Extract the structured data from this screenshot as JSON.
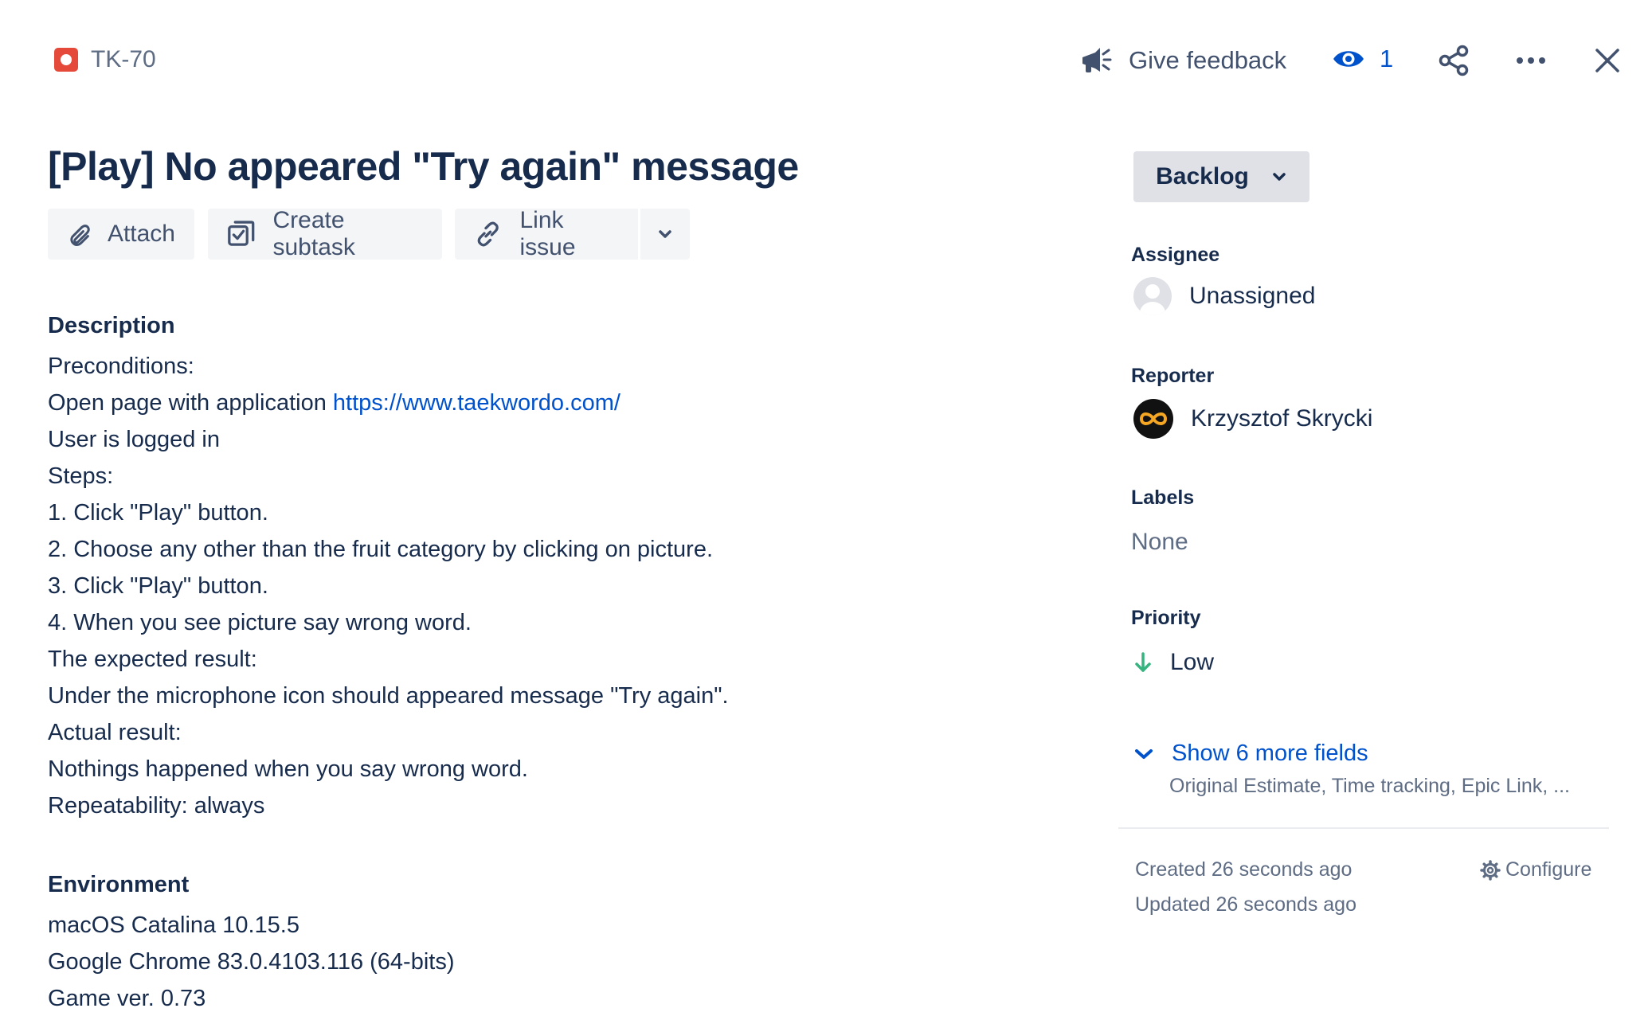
{
  "header": {
    "issue_key": "TK-70",
    "feedback_label": "Give feedback",
    "watch_count": "1",
    "icons": [
      "bug-icon",
      "megaphone-icon",
      "eye-icon",
      "share-icon",
      "more-icon",
      "close-icon"
    ]
  },
  "issue": {
    "title": "[Play] No appeared \"Try again\" message"
  },
  "toolbar": {
    "attach_label": "Attach",
    "create_subtask_label": "Create subtask",
    "link_issue_label": "Link issue"
  },
  "description": {
    "heading": "Description",
    "line_1": "Preconditions:",
    "line_2_text": "Open page with application ",
    "line_2_link": "https://www.taekwordo.com/",
    "line_3": "User is logged in",
    "line_4": "Steps:",
    "line_5": "1. Click \"Play\" button.",
    "line_6": "2. Choose any other than the fruit category by clicking on picture.",
    "line_7": "3. Click \"Play\" button.",
    "line_8": "4. When you see picture say wrong word.",
    "line_9": "The expected result:",
    "line_10": "Under the microphone icon should appeared message \"Try again\".",
    "line_11": "Actual result:",
    "line_12": "Nothings happened when you say wrong word.",
    "line_13": "Repeatability: always"
  },
  "environment": {
    "heading": "Environment",
    "line_1": "macOS Catalina 10.15.5",
    "line_2": "Google Chrome 83.0.4103.116 (64-bits)",
    "line_3": "Game ver. 0.73"
  },
  "sidebar": {
    "status": "Backlog",
    "assignee_label": "Assignee",
    "assignee_value": "Unassigned",
    "reporter_label": "Reporter",
    "reporter_value": "Krzysztof Skrycki",
    "labels_label": "Labels",
    "labels_value": "None",
    "priority_label": "Priority",
    "priority_value": "Low",
    "more_fields_label": "Show 6 more fields",
    "more_fields_sub": "Original Estimate, Time tracking, Epic Link, ...",
    "created": "Created 26 seconds ago",
    "updated": "Updated 26 seconds ago",
    "configure_label": "Configure"
  },
  "colors": {
    "text": "#172b4d",
    "link": "#0052cc",
    "muted": "#5e6c84",
    "bug": "#e5493a",
    "priority_low": "#36b37e"
  }
}
